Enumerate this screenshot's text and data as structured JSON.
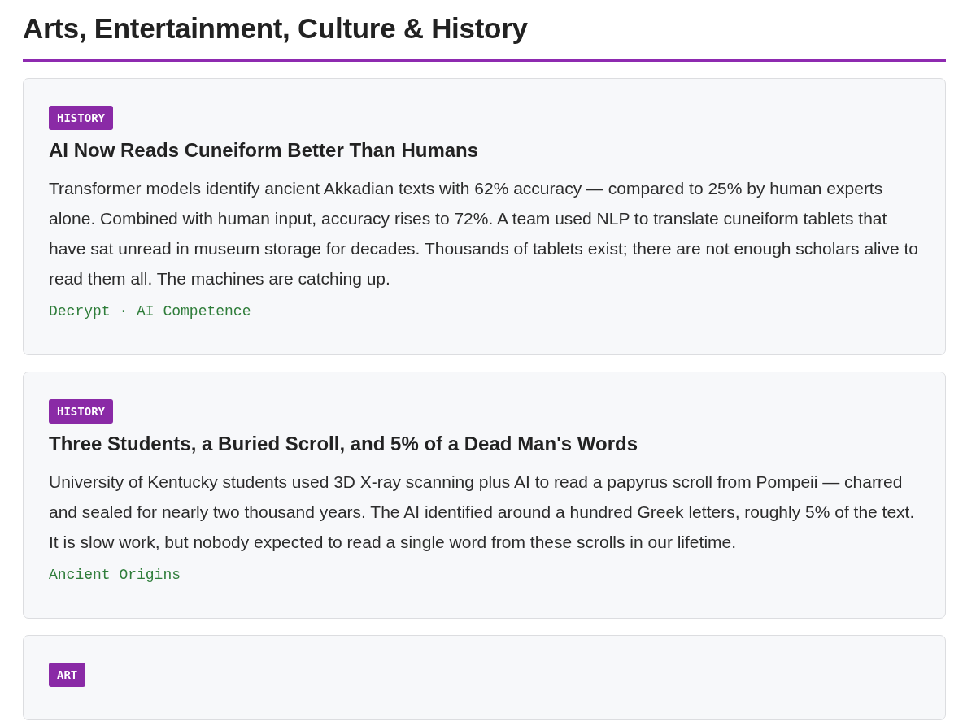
{
  "section": {
    "title": "Arts, Entertainment, Culture & History"
  },
  "articles": [
    {
      "tag": "HISTORY",
      "title": "AI Now Reads Cuneiform Better Than Humans",
      "body": "Transformer models identify ancient Akkadian texts with 62% accuracy — compared to 25% by human experts alone. Combined with human input, accuracy rises to 72%. A team used NLP to translate cuneiform tablets that have sat unread in museum storage for decades. Thousands of tablets exist; there are not enough scholars alive to read them all. The machines are catching up.",
      "source": "Decrypt · AI Competence"
    },
    {
      "tag": "HISTORY",
      "title": "Three Students, a Buried Scroll, and 5% of a Dead Man's Words",
      "body": "University of Kentucky students used 3D X-ray scanning plus AI to read a papyrus scroll from Pompeii — charred and sealed for nearly two thousand years. The AI identified around a hundred Greek letters, roughly 5% of the text. It is slow work, but nobody expected to read a single word from these scrolls in our lifetime.",
      "source": "Ancient Origins"
    },
    {
      "tag": "ART"
    }
  ]
}
